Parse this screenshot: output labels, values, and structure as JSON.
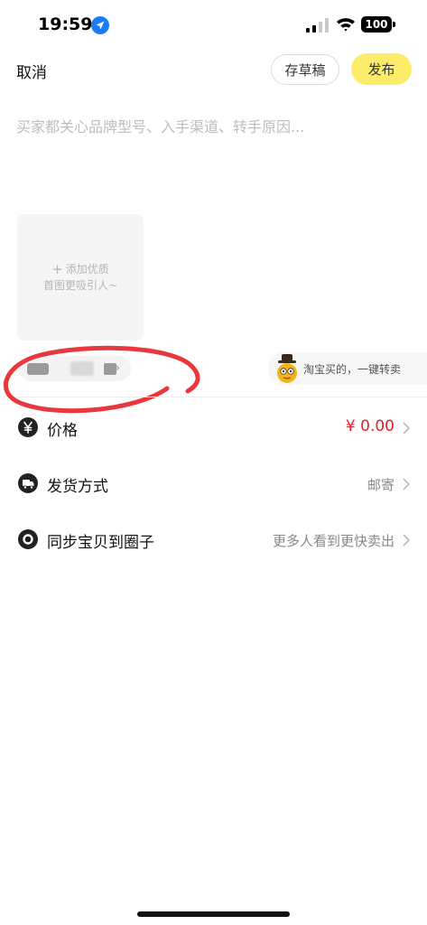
{
  "status_bar": {
    "time": "19:59",
    "battery": "100"
  },
  "header": {
    "cancel_label": "取消",
    "draft_label": "存草稿",
    "publish_label": "发布",
    "publish_color": "#fcec6a"
  },
  "description": {
    "placeholder": "买家都关心品牌型号、入手渠道、转手原因..."
  },
  "photo": {
    "line1": "添加优质",
    "line2": "首图更吸引人~"
  },
  "taobao": {
    "label": "淘宝买的，一键转卖"
  },
  "rows": [
    {
      "label": "价格",
      "value": "¥ 0.00",
      "icon": "yen-icon",
      "value_color": "#e0202a"
    },
    {
      "label": "发货方式",
      "value": "邮寄",
      "icon": "delivery-icon"
    },
    {
      "label": "同步宝贝到圈子",
      "value": "更多人看到更快卖出",
      "icon": "circle-icon"
    }
  ],
  "annotation_color": "#e8383d"
}
